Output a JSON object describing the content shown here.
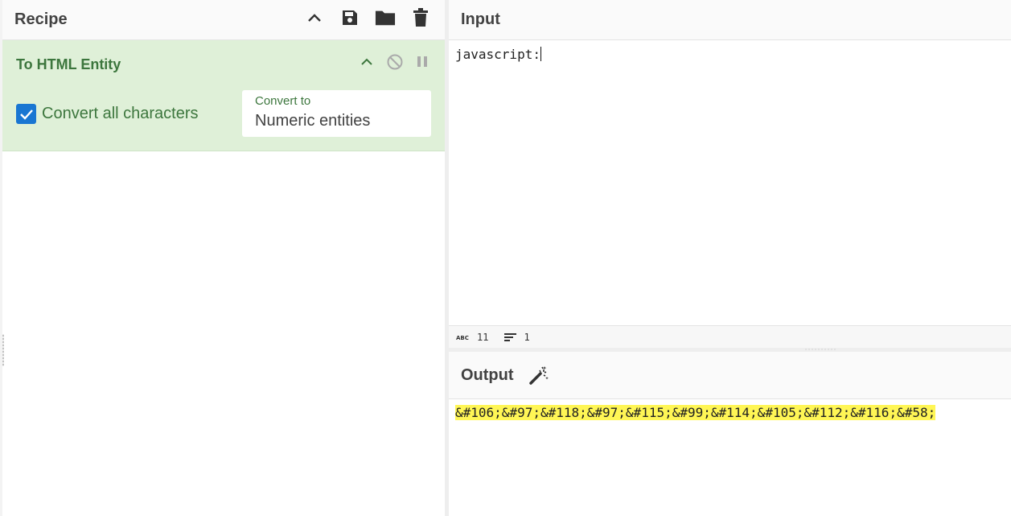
{
  "recipe": {
    "title": "Recipe",
    "icons": [
      "chevron-up-icon",
      "save-icon",
      "folder-icon",
      "trash-icon"
    ]
  },
  "operation": {
    "title": "To HTML Entity",
    "icons": [
      "chevron-up-icon",
      "disable-icon",
      "pause-icon"
    ],
    "checkbox_label": "Convert all characters",
    "checkbox_checked": true,
    "select_label": "Convert to",
    "select_value": "Numeric entities"
  },
  "input": {
    "title": "Input",
    "value": "javascript:",
    "status": {
      "length": "11",
      "lines": "1"
    }
  },
  "output": {
    "title": "Output",
    "value": "&#106;&#97;&#118;&#97;&#115;&#99;&#114;&#105;&#112;&#116;&#58;"
  },
  "colors": {
    "operation_bg": "#dff0d8",
    "operation_text": "#3c763d",
    "checkbox": "#1976d2",
    "highlight": "#fff655"
  }
}
